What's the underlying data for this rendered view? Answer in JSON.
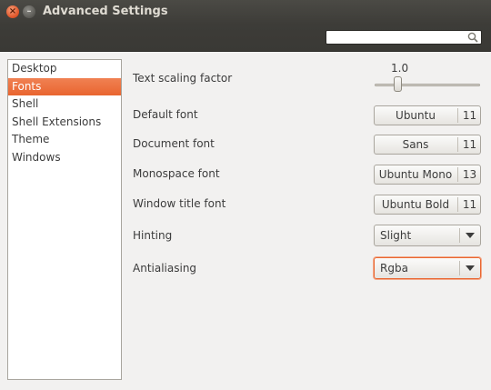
{
  "window": {
    "title": "Advanced Settings",
    "close_glyph": "×",
    "minimize_glyph": "–"
  },
  "search": {
    "value": "",
    "placeholder": ""
  },
  "sidebar": {
    "items": [
      {
        "label": "Desktop",
        "selected": false
      },
      {
        "label": "Fonts",
        "selected": true
      },
      {
        "label": "Shell",
        "selected": false
      },
      {
        "label": "Shell Extensions",
        "selected": false
      },
      {
        "label": "Theme",
        "selected": false
      },
      {
        "label": "Windows",
        "selected": false
      }
    ]
  },
  "settings": {
    "text_scaling": {
      "label": "Text scaling factor",
      "value_text": "1.0",
      "level": 0.2
    },
    "default_font": {
      "label": "Default font",
      "name": "Ubuntu",
      "size": "11"
    },
    "document_font": {
      "label": "Document font",
      "name": "Sans",
      "size": "11"
    },
    "monospace_font": {
      "label": "Monospace font",
      "name": "Ubuntu Mono",
      "size": "13"
    },
    "window_title_font": {
      "label": "Window title font",
      "name": "Ubuntu Bold",
      "size": "11"
    },
    "hinting": {
      "label": "Hinting",
      "value": "Slight"
    },
    "antialiasing": {
      "label": "Antialiasing",
      "value": "Rgba"
    }
  },
  "colors": {
    "accent": "#e9652f",
    "titlebar": "#3d3c38",
    "window_bg": "#f2f1f0"
  },
  "icons": {
    "search": "search-icon",
    "close": "close-icon",
    "minimize": "minimize-icon",
    "dropdown": "chevron-down-icon"
  }
}
